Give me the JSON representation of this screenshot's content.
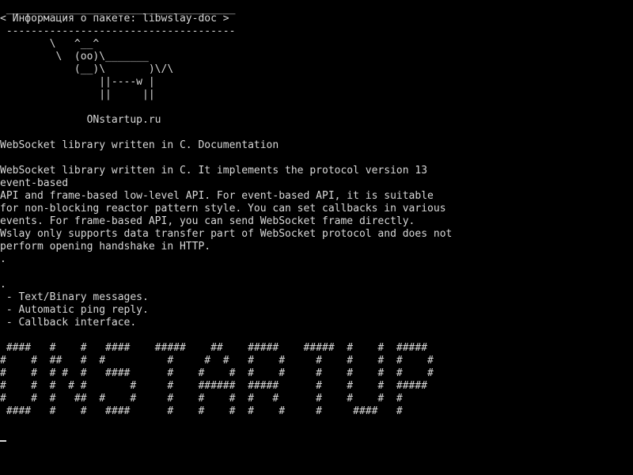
{
  "terminal": {
    "banner": {
      "rule_top": " _____________________________________",
      "title_line": "< Информация о пакете: libwslay-doc >",
      "rule_bottom": " -------------------------------------",
      "cow_1": "        \\   ^__^",
      "cow_2": "         \\  (oo)\\_______",
      "cow_3": "            (__)\\       )\\/\\",
      "cow_4": "                ||----w |",
      "cow_5": "                ||     ||",
      "site": "              ONstartup.ru"
    },
    "summary": "WebSocket library written in C. Documentation",
    "description": [
      "WebSocket library written in C. It implements the protocol version 13",
      "event-based",
      "API and frame-based low-level API. For event-based API, it is suitable",
      "for non-blocking reactor pattern style. You can set callbacks in various",
      "events. For frame-based API, you can send WebSocket frame directly.",
      "Wslay only supports data transfer part of WebSocket protocol and does not",
      "perform opening handshake in HTTP.",
      "."
    ],
    "features": [
      ".",
      " - Text/Binary messages.",
      " - Automatic ping reply.",
      " - Callback interface."
    ],
    "ascii_art": [
      " ####   #    #   ####    #####    ##    #####    #####  #    #  #####",
      "#    #  ##   #  #          #     #  #   #    #     #    #    #  #    #",
      "#    #  # #  #   ####      #    #    #  #    #     #    #    #  #    #",
      "#    #  #  # #       #     #    ######  #####      #    #    #  #####",
      "#    #  #   ##  #    #     #    #    #  #   #      #    #    #  #",
      " ####   #    #   ####      #    #    #  #    #     #     ####   #"
    ]
  }
}
